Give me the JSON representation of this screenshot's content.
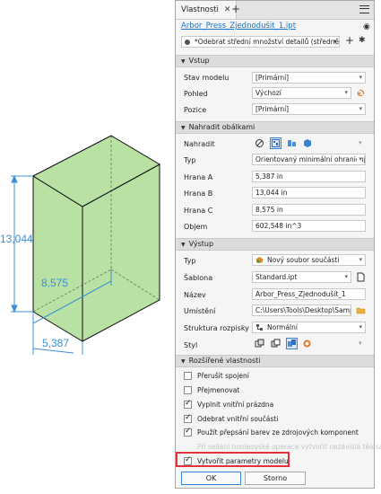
{
  "drawing": {
    "dim_height": "13,044",
    "dim_depth": "8,575",
    "dim_width": "5,387",
    "box_color": "#b9e1a3",
    "dim_color": "#3d8fd8"
  },
  "panel": {
    "tab_title": "Vlastnosti",
    "file_name": "Arbor_Press_Zjednodušit_1.ipt",
    "simplification": "*Odebrat střední množství detailů (středně v",
    "sections": {
      "input": {
        "title": "Vstup",
        "model_state_label": "Stav modelu",
        "model_state_value": "[Primární]",
        "view_label": "Pohled",
        "view_value": "Výchozí",
        "position_label": "Pozice",
        "position_value": "[Primární]"
      },
      "envelopes": {
        "title": "Nahradit obálkami",
        "replace_label": "Nahradit",
        "type_label": "Typ",
        "type_value": "Orientovaný minimální ohraničujíc",
        "edge_a_label": "Hrana A",
        "edge_a_value": "5,387 in",
        "edge_b_label": "Hrana B",
        "edge_b_value": "13,044 in",
        "edge_c_label": "Hrana C",
        "edge_c_value": "8,575 in",
        "volume_label": "Objem",
        "volume_value": "602,548 in^3"
      },
      "output": {
        "title": "Výstup",
        "type_label": "Typ",
        "type_value": "Nový soubor součásti",
        "template_label": "Šablona",
        "template_value": "Standard.ipt",
        "name_label": "Název",
        "name_value": "Arbor_Press_Zjednodušit_1",
        "location_label": "Umístění",
        "location_value": "C:\\Users\\Tools\\Desktop\\Samples",
        "structure_label": "Struktura rozpisky",
        "structure_value": "Normální",
        "style_label": "Styl"
      },
      "advanced": {
        "title": "Rozšířené vlastnosti",
        "options": [
          {
            "label": "Přerušit spojení",
            "checked": false,
            "disabled": false
          },
          {
            "label": "Přejmenovat",
            "checked": false,
            "disabled": false
          },
          {
            "label": "Vyplnit vnitřní prázdna",
            "checked": true,
            "disabled": false
          },
          {
            "label": "Odebrat vnitřní součásti",
            "checked": true,
            "disabled": false
          },
          {
            "label": "Použít přepsání barev ze zdrojových komponent",
            "checked": true,
            "disabled": false
          },
          {
            "label": "Při sellání booleovské operace vytvořit nezávislá tělesa",
            "checked": false,
            "disabled": true
          },
          {
            "label": "Vytvořit parametry modelu",
            "checked": true,
            "disabled": false
          }
        ]
      }
    },
    "ok_label": "OK",
    "cancel_label": "Storno"
  }
}
